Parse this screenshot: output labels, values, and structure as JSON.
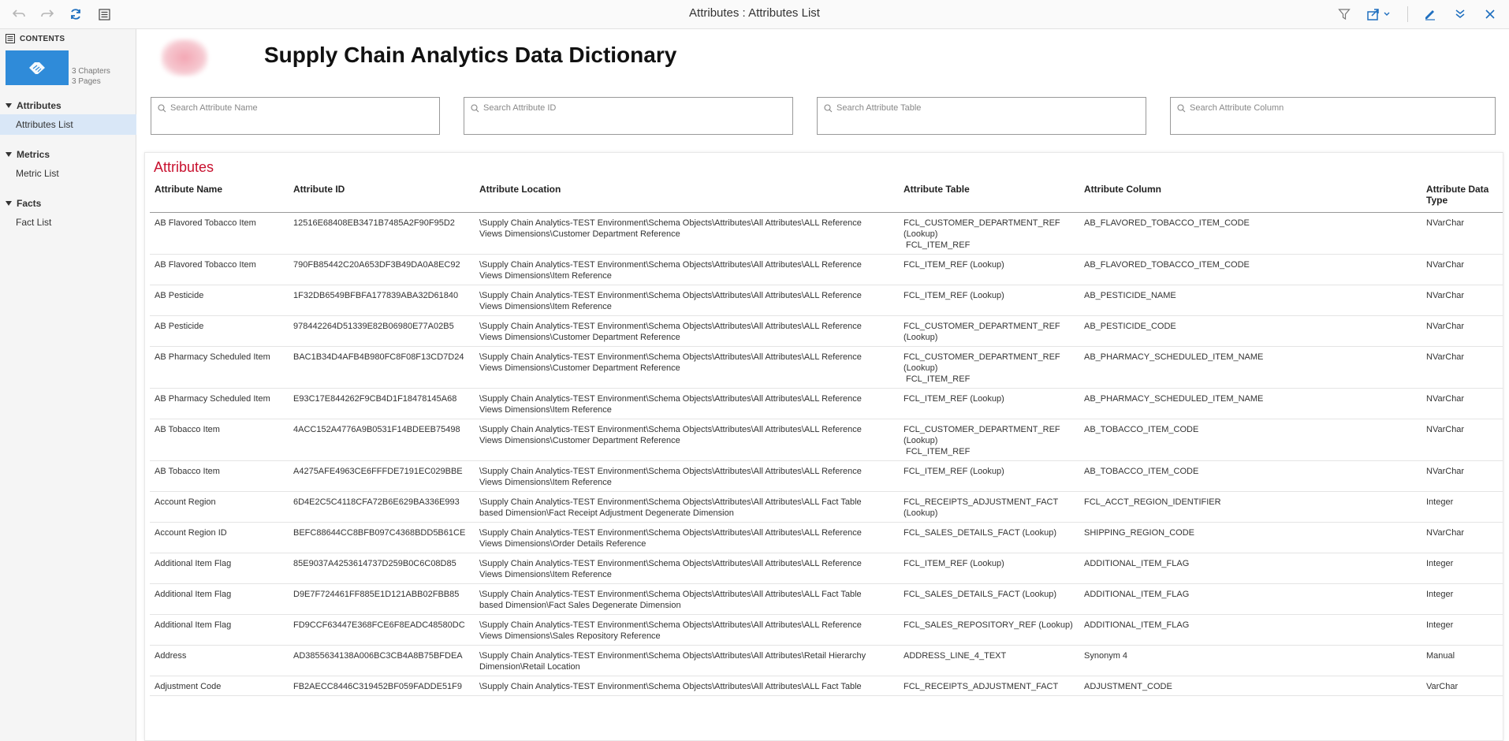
{
  "window": {
    "title": "Attributes : Attributes List"
  },
  "sidebar": {
    "contents_label": "CONTENTS",
    "chapters": "3 Chapters",
    "pages": "3 Pages",
    "sections": [
      {
        "title": "Attributes",
        "items": [
          {
            "label": "Attributes List"
          }
        ]
      },
      {
        "title": "Metrics",
        "items": [
          {
            "label": "Metric List"
          }
        ]
      },
      {
        "title": "Facts",
        "items": [
          {
            "label": "Fact List"
          }
        ]
      }
    ]
  },
  "main": {
    "doc_title": "Supply Chain Analytics Data Dictionary",
    "search": {
      "name_placeholder": "Search Attribute Name",
      "id_placeholder": "Search Attribute ID",
      "table_placeholder": "Search Attribute Table",
      "column_placeholder": "Search Attribute Column"
    },
    "panel_title": "Attributes",
    "columns": [
      "Attribute Name",
      "Attribute ID",
      "Attribute Location",
      "Attribute Table",
      "Attribute Column",
      "Attribute Data Type"
    ],
    "rows": [
      {
        "name": "AB Flavored Tobacco Item",
        "id": "12516E68408EB3471B7485A2F90F95D2",
        "location": "\\Supply Chain Analytics-TEST Environment\\Schema Objects\\Attributes\\All Attributes\\ALL Reference Views Dimensions\\Customer Department Reference",
        "table": [
          "FCL_CUSTOMER_DEPARTMENT_REF (Lookup)",
          "FCL_ITEM_REF"
        ],
        "column": "AB_FLAVORED_TOBACCO_ITEM_CODE",
        "type": "NVarChar"
      },
      {
        "name": "AB Flavored Tobacco Item",
        "id": "790FB85442C20A653DF3B49DA0A8EC92",
        "location": "\\Supply Chain Analytics-TEST Environment\\Schema Objects\\Attributes\\All Attributes\\ALL Reference Views Dimensions\\Item Reference",
        "table": [
          "FCL_ITEM_REF (Lookup)"
        ],
        "column": "AB_FLAVORED_TOBACCO_ITEM_CODE",
        "type": "NVarChar"
      },
      {
        "name": "AB Pesticide",
        "id": "1F32DB6549BFBFA177839ABA32D61840",
        "location": "\\Supply Chain Analytics-TEST Environment\\Schema Objects\\Attributes\\All Attributes\\ALL Reference Views Dimensions\\Item Reference",
        "table": [
          "FCL_ITEM_REF (Lookup)"
        ],
        "column": "AB_PESTICIDE_NAME",
        "type": "NVarChar"
      },
      {
        "name": "AB Pesticide",
        "id": "978442264D51339E82B06980E77A02B5",
        "location": "\\Supply Chain Analytics-TEST Environment\\Schema Objects\\Attributes\\All Attributes\\ALL Reference Views Dimensions\\Customer Department Reference",
        "table": [
          "FCL_CUSTOMER_DEPARTMENT_REF (Lookup)"
        ],
        "column": "AB_PESTICIDE_CODE",
        "type": "NVarChar"
      },
      {
        "name": "AB Pharmacy Scheduled Item",
        "id": "BAC1B34D4AFB4B980FC8F08F13CD7D24",
        "location": "\\Supply Chain Analytics-TEST Environment\\Schema Objects\\Attributes\\All Attributes\\ALL Reference Views Dimensions\\Customer Department Reference",
        "table": [
          "FCL_CUSTOMER_DEPARTMENT_REF (Lookup)",
          "FCL_ITEM_REF"
        ],
        "column": "AB_PHARMACY_SCHEDULED_ITEM_NAME",
        "type": "NVarChar"
      },
      {
        "name": "AB Pharmacy Scheduled Item",
        "id": "E93C17E844262F9CB4D1F18478145A68",
        "location": "\\Supply Chain Analytics-TEST Environment\\Schema Objects\\Attributes\\All Attributes\\ALL Reference Views Dimensions\\Item Reference",
        "table": [
          "FCL_ITEM_REF (Lookup)"
        ],
        "column": "AB_PHARMACY_SCHEDULED_ITEM_NAME",
        "type": "NVarChar"
      },
      {
        "name": "AB Tobacco Item",
        "id": "4ACC152A4776A9B0531F14BDEEB75498",
        "location": "\\Supply Chain Analytics-TEST Environment\\Schema Objects\\Attributes\\All Attributes\\ALL Reference Views Dimensions\\Customer Department Reference",
        "table": [
          "FCL_CUSTOMER_DEPARTMENT_REF (Lookup)",
          "FCL_ITEM_REF"
        ],
        "column": "AB_TOBACCO_ITEM_CODE",
        "type": "NVarChar"
      },
      {
        "name": "AB Tobacco Item",
        "id": "A4275AFE4963CE6FFFDE7191EC029BBE",
        "location": "\\Supply Chain Analytics-TEST Environment\\Schema Objects\\Attributes\\All Attributes\\ALL Reference Views Dimensions\\Item Reference",
        "table": [
          "FCL_ITEM_REF (Lookup)"
        ],
        "column": "AB_TOBACCO_ITEM_CODE",
        "type": "NVarChar"
      },
      {
        "name": "Account Region",
        "id": "6D4E2C5C4118CFA72B6E629BA336E993",
        "location": "\\Supply Chain Analytics-TEST Environment\\Schema Objects\\Attributes\\All Attributes\\ALL Fact Table based Dimension\\Fact Receipt Adjustment Degenerate Dimension",
        "table": [
          "FCL_RECEIPTS_ADJUSTMENT_FACT (Lookup)"
        ],
        "column": "FCL_ACCT_REGION_IDENTIFIER",
        "type": "Integer"
      },
      {
        "name": "Account Region ID",
        "id": "BEFC88644CC8BFB097C4368BDD5B61CE",
        "location": "\\Supply Chain Analytics-TEST Environment\\Schema Objects\\Attributes\\All Attributes\\ALL Reference Views Dimensions\\Order Details Reference",
        "table": [
          "FCL_SALES_DETAILS_FACT (Lookup)"
        ],
        "column": "SHIPPING_REGION_CODE",
        "type": "NVarChar"
      },
      {
        "name": "Additional Item Flag",
        "id": "85E9037A4253614737D259B0C6C08D85",
        "location": "\\Supply Chain Analytics-TEST Environment\\Schema Objects\\Attributes\\All Attributes\\ALL Reference Views Dimensions\\Item Reference",
        "table": [
          "FCL_ITEM_REF (Lookup)"
        ],
        "column": "ADDITIONAL_ITEM_FLAG",
        "type": "Integer"
      },
      {
        "name": "Additional Item Flag",
        "id": "D9E7F724461FF885E1D121ABB02FBB85",
        "location": "\\Supply Chain Analytics-TEST Environment\\Schema Objects\\Attributes\\All Attributes\\ALL Fact Table based Dimension\\Fact Sales Degenerate Dimension",
        "table": [
          "FCL_SALES_DETAILS_FACT (Lookup)"
        ],
        "column": "ADDITIONAL_ITEM_FLAG",
        "type": "Integer"
      },
      {
        "name": "Additional Item Flag",
        "id": "FD9CCF63447E368FCE6F8EADC48580DC",
        "location": "\\Supply Chain Analytics-TEST Environment\\Schema Objects\\Attributes\\All Attributes\\ALL Reference Views Dimensions\\Sales Repository Reference",
        "table": [
          "FCL_SALES_REPOSITORY_REF (Lookup)"
        ],
        "column": "ADDITIONAL_ITEM_FLAG",
        "type": "Integer"
      },
      {
        "name": "Address",
        "id": "AD3855634138A006BC3CB4A8B75BFDEA",
        "location": "\\Supply Chain Analytics-TEST Environment\\Schema Objects\\Attributes\\All Attributes\\Retail Hierarchy Dimension\\Retail Location",
        "table": [
          "ADDRESS_LINE_4_TEXT"
        ],
        "column": "Synonym 4",
        "type": "Manual"
      },
      {
        "name": "Adjustment Code",
        "id": "FB2AECC8446C319452BF059FADDE51F9",
        "location": "\\Supply Chain Analytics-TEST Environment\\Schema Objects\\Attributes\\All Attributes\\ALL Fact Table",
        "table": [
          "FCL_RECEIPTS_ADJUSTMENT_FACT"
        ],
        "column": "ADJUSTMENT_CODE",
        "type": "VarChar"
      }
    ]
  }
}
